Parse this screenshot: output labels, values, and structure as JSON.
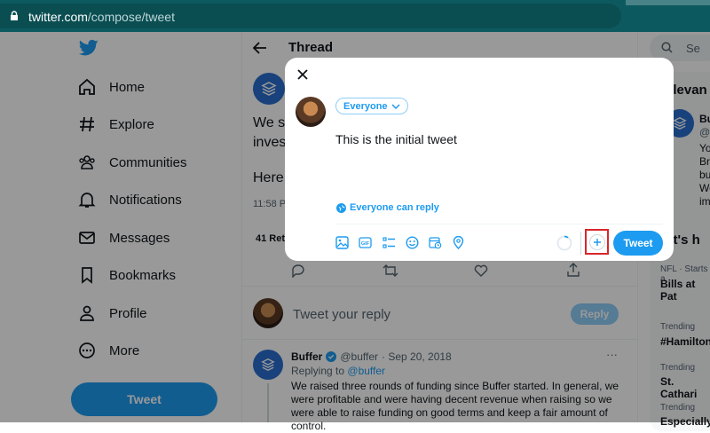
{
  "browser": {
    "url_host": "twitter.com",
    "url_path": "/compose/tweet"
  },
  "sidebar": {
    "items": [
      {
        "label": "Home",
        "icon": "home-icon"
      },
      {
        "label": "Explore",
        "icon": "hashtag-icon"
      },
      {
        "label": "Communities",
        "icon": "communities-icon"
      },
      {
        "label": "Notifications",
        "icon": "bell-icon"
      },
      {
        "label": "Messages",
        "icon": "envelope-icon"
      },
      {
        "label": "Bookmarks",
        "icon": "bookmark-icon"
      },
      {
        "label": "Profile",
        "icon": "person-icon"
      },
      {
        "label": "More",
        "icon": "more-circle-icon"
      }
    ],
    "tweet_label": "Tweet"
  },
  "main": {
    "header_title": "Thread",
    "partial_lines": [
      "We s",
      "inves",
      "Here",
      "11:58 P",
      "41 Retw"
    ],
    "reply_placeholder": "Tweet your reply",
    "reply_button": "Reply",
    "reply_tweet": {
      "name": "Buffer",
      "handle": "@buffer",
      "date": "· Sep 20, 2018",
      "replying_prefix": "Replying to",
      "replying_handle": "@buffer",
      "text": "We raised three rounds of funding since Buffer started. In general, we were profitable and were having decent revenue when raising so we were able to raise funding on good terms and keep a fair amount of control.",
      "more": "···"
    }
  },
  "right": {
    "search_placeholder": "Se",
    "relevant_title": "elevan",
    "relevant_name": "Bu",
    "relevant_handle": "@b",
    "relevant_bio": [
      "Yo",
      "Bra",
      "bu",
      "We",
      "im"
    ],
    "whats_title": "hat's h",
    "trends": [
      {
        "meta": "NFL · Starts a",
        "title": "Bills at Pat"
      },
      {
        "meta": "Trending",
        "title": "#Hamilton"
      },
      {
        "meta": "Trending",
        "title": "St. Cathari"
      },
      {
        "meta": "Trending",
        "title": "Especially"
      }
    ]
  },
  "compose": {
    "audience": "Everyone",
    "text": "This is the initial tweet",
    "reply_setting": "Everyone can reply",
    "tweet_button": "Tweet",
    "toolbar_icons": [
      "image-icon",
      "gif-icon",
      "poll-icon",
      "emoji-icon",
      "schedule-icon",
      "location-icon"
    ],
    "colors": {
      "accent": "#1d9bf0",
      "highlight": "#d9262c"
    }
  }
}
